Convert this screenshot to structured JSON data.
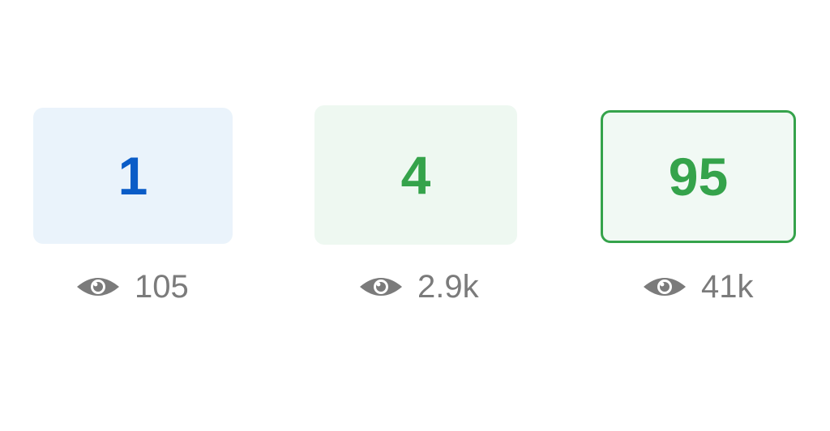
{
  "cards": [
    {
      "number": "1",
      "views": "105"
    },
    {
      "number": "4",
      "views": "2.9k"
    },
    {
      "number": "95",
      "views": "41k"
    }
  ],
  "icons": {
    "views": "eye-icon"
  },
  "colors": {
    "blue": "#0a5cc7",
    "green": "#35a34b",
    "gray": "#7b7b7b",
    "blue_bg": "#eaf3fb",
    "green_bg": "#eef8f1"
  }
}
